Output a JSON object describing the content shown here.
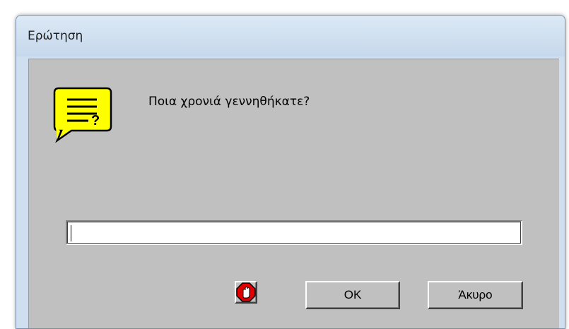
{
  "window": {
    "title": "Ερώτηση"
  },
  "dialog": {
    "prompt": "Ποια χρονιά γεννηθήκατε?",
    "input_value": "",
    "icon": "question-bubble-icon",
    "buttons": {
      "stop_icon": "stop-hand-icon",
      "ok_label": "OK",
      "cancel_label": "Άκυρο"
    }
  },
  "colors": {
    "title_bar": "#cfdff0",
    "client_bg": "#c0c0c0",
    "icon_fill": "#ffff00",
    "stop_red": "#e00000"
  }
}
